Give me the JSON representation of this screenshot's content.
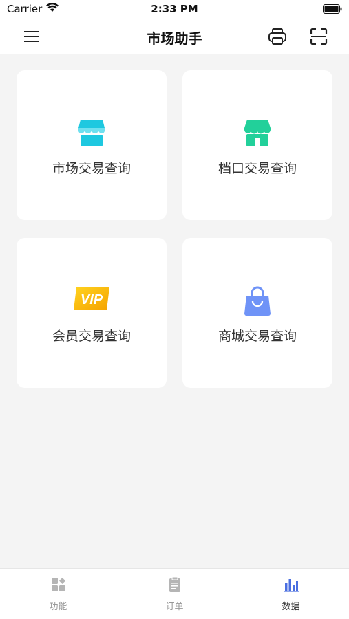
{
  "status_bar": {
    "carrier": "Carrier",
    "time": "2:33 PM"
  },
  "nav": {
    "title": "市场助手",
    "menu_icon": "menu-icon",
    "print_icon": "printer-icon",
    "scan_icon": "scan-icon"
  },
  "cards": [
    {
      "label": "市场交易查询",
      "icon": "market-store-icon",
      "color": "#1ec8e0"
    },
    {
      "label": "档口交易查询",
      "icon": "stall-store-icon",
      "color": "#22d09a"
    },
    {
      "label": "会员交易查询",
      "icon": "vip-icon",
      "icon_text": "VIP",
      "color": "#f7b500"
    },
    {
      "label": "商城交易查询",
      "icon": "shopping-bag-icon",
      "color": "#6f93f7"
    }
  ],
  "tabs": [
    {
      "label": "功能",
      "icon": "grid-icon",
      "active": false
    },
    {
      "label": "订单",
      "icon": "clipboard-icon",
      "active": false
    },
    {
      "label": "数据",
      "icon": "bar-chart-icon",
      "active": true
    }
  ],
  "colors": {
    "background": "#f4f4f4",
    "tab_active": "#4a6ee0",
    "tab_inactive": "#b5b5b5"
  }
}
